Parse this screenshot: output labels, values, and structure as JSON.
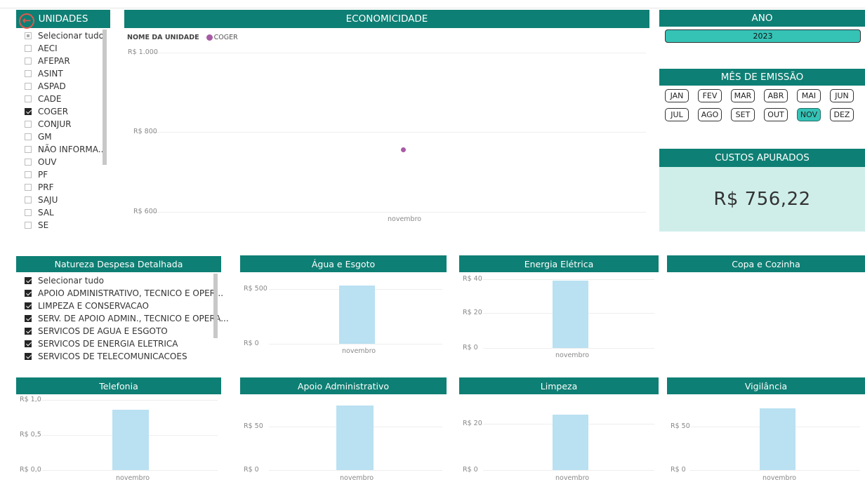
{
  "unidades": {
    "title": "UNIDADES",
    "items": [
      {
        "label": "Selecionar tudo",
        "state": "partial"
      },
      {
        "label": "AECI",
        "state": "unchecked"
      },
      {
        "label": "AFEPAR",
        "state": "unchecked"
      },
      {
        "label": "ASINT",
        "state": "unchecked"
      },
      {
        "label": "ASPAD",
        "state": "unchecked"
      },
      {
        "label": "CADE",
        "state": "unchecked"
      },
      {
        "label": "COGER",
        "state": "checked"
      },
      {
        "label": "CONJUR",
        "state": "unchecked"
      },
      {
        "label": "GM",
        "state": "unchecked"
      },
      {
        "label": "NÃO INFORMA...",
        "state": "unchecked"
      },
      {
        "label": "OUV",
        "state": "unchecked"
      },
      {
        "label": "PF",
        "state": "unchecked"
      },
      {
        "label": "PRF",
        "state": "unchecked"
      },
      {
        "label": "SAJU",
        "state": "unchecked"
      },
      {
        "label": "SAL",
        "state": "unchecked"
      },
      {
        "label": "SE",
        "state": "unchecked"
      }
    ]
  },
  "economicidade": {
    "title": "ECONOMICIDADE",
    "legend_title": "NOME DA UNIDADE",
    "legend_series": "COGER",
    "y_ticks": [
      "R$ 1.000",
      "R$ 800",
      "R$ 600"
    ],
    "x_label": "novembro"
  },
  "ano": {
    "title": "ANO",
    "value": "2023"
  },
  "mes": {
    "title": "MÊS DE EMISSÃO",
    "months": [
      {
        "label": "JAN",
        "selected": false
      },
      {
        "label": "FEV",
        "selected": false
      },
      {
        "label": "MAR",
        "selected": false
      },
      {
        "label": "ABR",
        "selected": false
      },
      {
        "label": "MAI",
        "selected": false
      },
      {
        "label": "JUN",
        "selected": false
      },
      {
        "label": "JUL",
        "selected": false
      },
      {
        "label": "AGO",
        "selected": false
      },
      {
        "label": "SET",
        "selected": false
      },
      {
        "label": "OUT",
        "selected": false
      },
      {
        "label": "NOV",
        "selected": true
      },
      {
        "label": "DEZ",
        "selected": false
      }
    ]
  },
  "custos": {
    "title": "CUSTOS APURADOS",
    "value": "R$ 756,22"
  },
  "natureza": {
    "title": "Natureza Despesa Detalhada",
    "items": [
      {
        "label": "Selecionar tudo",
        "state": "checked"
      },
      {
        "label": "APOIO ADMINISTRATIVO, TECNICO E OPER...",
        "state": "checked"
      },
      {
        "label": "LIMPEZA E CONSERVACAO",
        "state": "checked"
      },
      {
        "label": "SERV. DE APOIO ADMIN., TECNICO E OPERA...",
        "state": "checked"
      },
      {
        "label": "SERVICOS DE AGUA E ESGOTO",
        "state": "checked"
      },
      {
        "label": "SERVICOS DE ENERGIA ELETRICA",
        "state": "checked"
      },
      {
        "label": "SERVICOS DE TELECOMUNICACOES",
        "state": "checked"
      }
    ]
  },
  "panels": {
    "agua": {
      "title": "Água e Esgoto",
      "y_ticks": [
        "R$ 500",
        "R$ 0"
      ],
      "x_label": "novembro"
    },
    "energia": {
      "title": "Energia Elétrica",
      "y_ticks": [
        "R$ 40",
        "R$ 20",
        "R$ 0"
      ],
      "x_label": "novembro"
    },
    "copa": {
      "title": "Copa e Cozinha"
    },
    "telefonia": {
      "title": "Telefonia",
      "y_ticks": [
        "R$ 1,0",
        "R$ 0,5",
        "R$ 0,0"
      ],
      "x_label": "novembro"
    },
    "apoio": {
      "title": "Apoio Administrativo",
      "y_ticks": [
        "R$ 50",
        "R$ 0"
      ],
      "x_label": "novembro"
    },
    "limpeza": {
      "title": "Limpeza",
      "y_ticks": [
        "R$ 20",
        "R$ 0"
      ],
      "x_label": "novembro"
    },
    "vigilancia": {
      "title": "Vigilância",
      "y_ticks": [
        "R$ 50",
        "R$ 0"
      ],
      "x_label": "novembro"
    }
  },
  "chart_data": [
    {
      "type": "scatter",
      "title": "ECONOMICIDADE",
      "legend_title": "NOME DA UNIDADE",
      "series": [
        {
          "name": "COGER",
          "x": [
            "novembro"
          ],
          "values": [
            756.22
          ]
        }
      ],
      "ylim": [
        600,
        1000
      ],
      "y_ticks": [
        "R$ 1.000",
        "R$ 800",
        "R$ 600"
      ],
      "grid": true,
      "legend": "top-left"
    },
    {
      "type": "bar",
      "title": "Água e Esgoto",
      "categories": [
        "novembro"
      ],
      "values": [
        530
      ],
      "ylim": [
        0,
        500
      ],
      "y_ticks": [
        "R$ 500",
        "R$ 0"
      ],
      "grid": true
    },
    {
      "type": "bar",
      "title": "Energia Elétrica",
      "categories": [
        "novembro"
      ],
      "values": [
        39
      ],
      "ylim": [
        0,
        40
      ],
      "y_ticks": [
        "R$ 40",
        "R$ 20",
        "R$ 0"
      ],
      "grid": true
    },
    {
      "type": "bar",
      "title": "Telefonia",
      "categories": [
        "novembro"
      ],
      "values": [
        0.86
      ],
      "ylim": [
        0,
        1
      ],
      "y_ticks": [
        "R$ 1,0",
        "R$ 0,5",
        "R$ 0,0"
      ],
      "grid": true
    },
    {
      "type": "bar",
      "title": "Apoio Administrativo",
      "categories": [
        "novembro"
      ],
      "values": [
        74
      ],
      "ylim": [
        0,
        50
      ],
      "y_ticks": [
        "R$ 50",
        "R$ 0"
      ],
      "grid": true
    },
    {
      "type": "bar",
      "title": "Limpeza",
      "categories": [
        "novembro"
      ],
      "values": [
        24
      ],
      "ylim": [
        0,
        20
      ],
      "y_ticks": [
        "R$ 20",
        "R$ 0"
      ],
      "grid": true
    },
    {
      "type": "bar",
      "title": "Vigilância",
      "categories": [
        "novembro"
      ],
      "values": [
        71
      ],
      "ylim": [
        0,
        50
      ],
      "y_ticks": [
        "R$ 50",
        "R$ 0"
      ],
      "grid": true
    }
  ]
}
